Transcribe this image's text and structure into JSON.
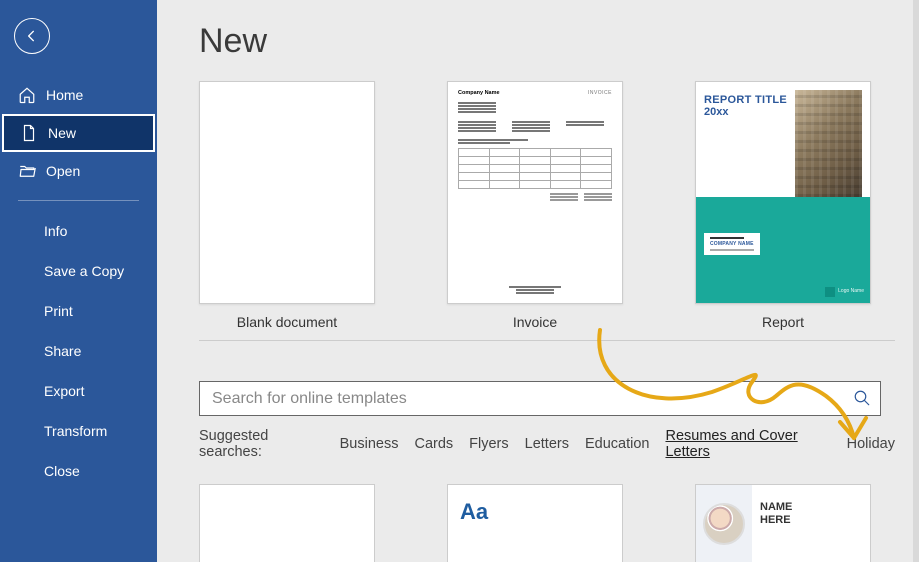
{
  "colors": {
    "brand": "#2b579a",
    "sidebar_selected": "#103469",
    "teal": "#1aa99a",
    "annotation": "#e6a817"
  },
  "back_button": "Back",
  "nav_primary": [
    {
      "label": "Home",
      "icon": "home"
    },
    {
      "label": "New",
      "icon": "document"
    },
    {
      "label": "Open",
      "icon": "folder"
    }
  ],
  "nav_secondary": [
    {
      "label": "Info"
    },
    {
      "label": "Save a Copy"
    },
    {
      "label": "Print"
    },
    {
      "label": "Share"
    },
    {
      "label": "Export"
    },
    {
      "label": "Transform"
    },
    {
      "label": "Close"
    }
  ],
  "page_title": "New",
  "templates": [
    {
      "label": "Blank document"
    },
    {
      "label": "Invoice"
    },
    {
      "label": "Report"
    }
  ],
  "invoice_preview": {
    "company": "Company Name",
    "heading": "INVOICE"
  },
  "report_preview": {
    "title_line1": "REPORT TITLE",
    "title_line2": "20xx",
    "company": "COMPANY NAME",
    "logo_text": "Logo Name"
  },
  "search": {
    "placeholder": "Search for online templates"
  },
  "suggested": {
    "lead": "Suggested searches:",
    "items": [
      "Business",
      "Cards",
      "Flyers",
      "Letters",
      "Education",
      "Resumes and Cover Letters",
      "Holiday"
    ],
    "highlighted_index": 5
  },
  "peek": {
    "aa": "Aa",
    "resume_line1": "NAME",
    "resume_line2": "HERE"
  }
}
